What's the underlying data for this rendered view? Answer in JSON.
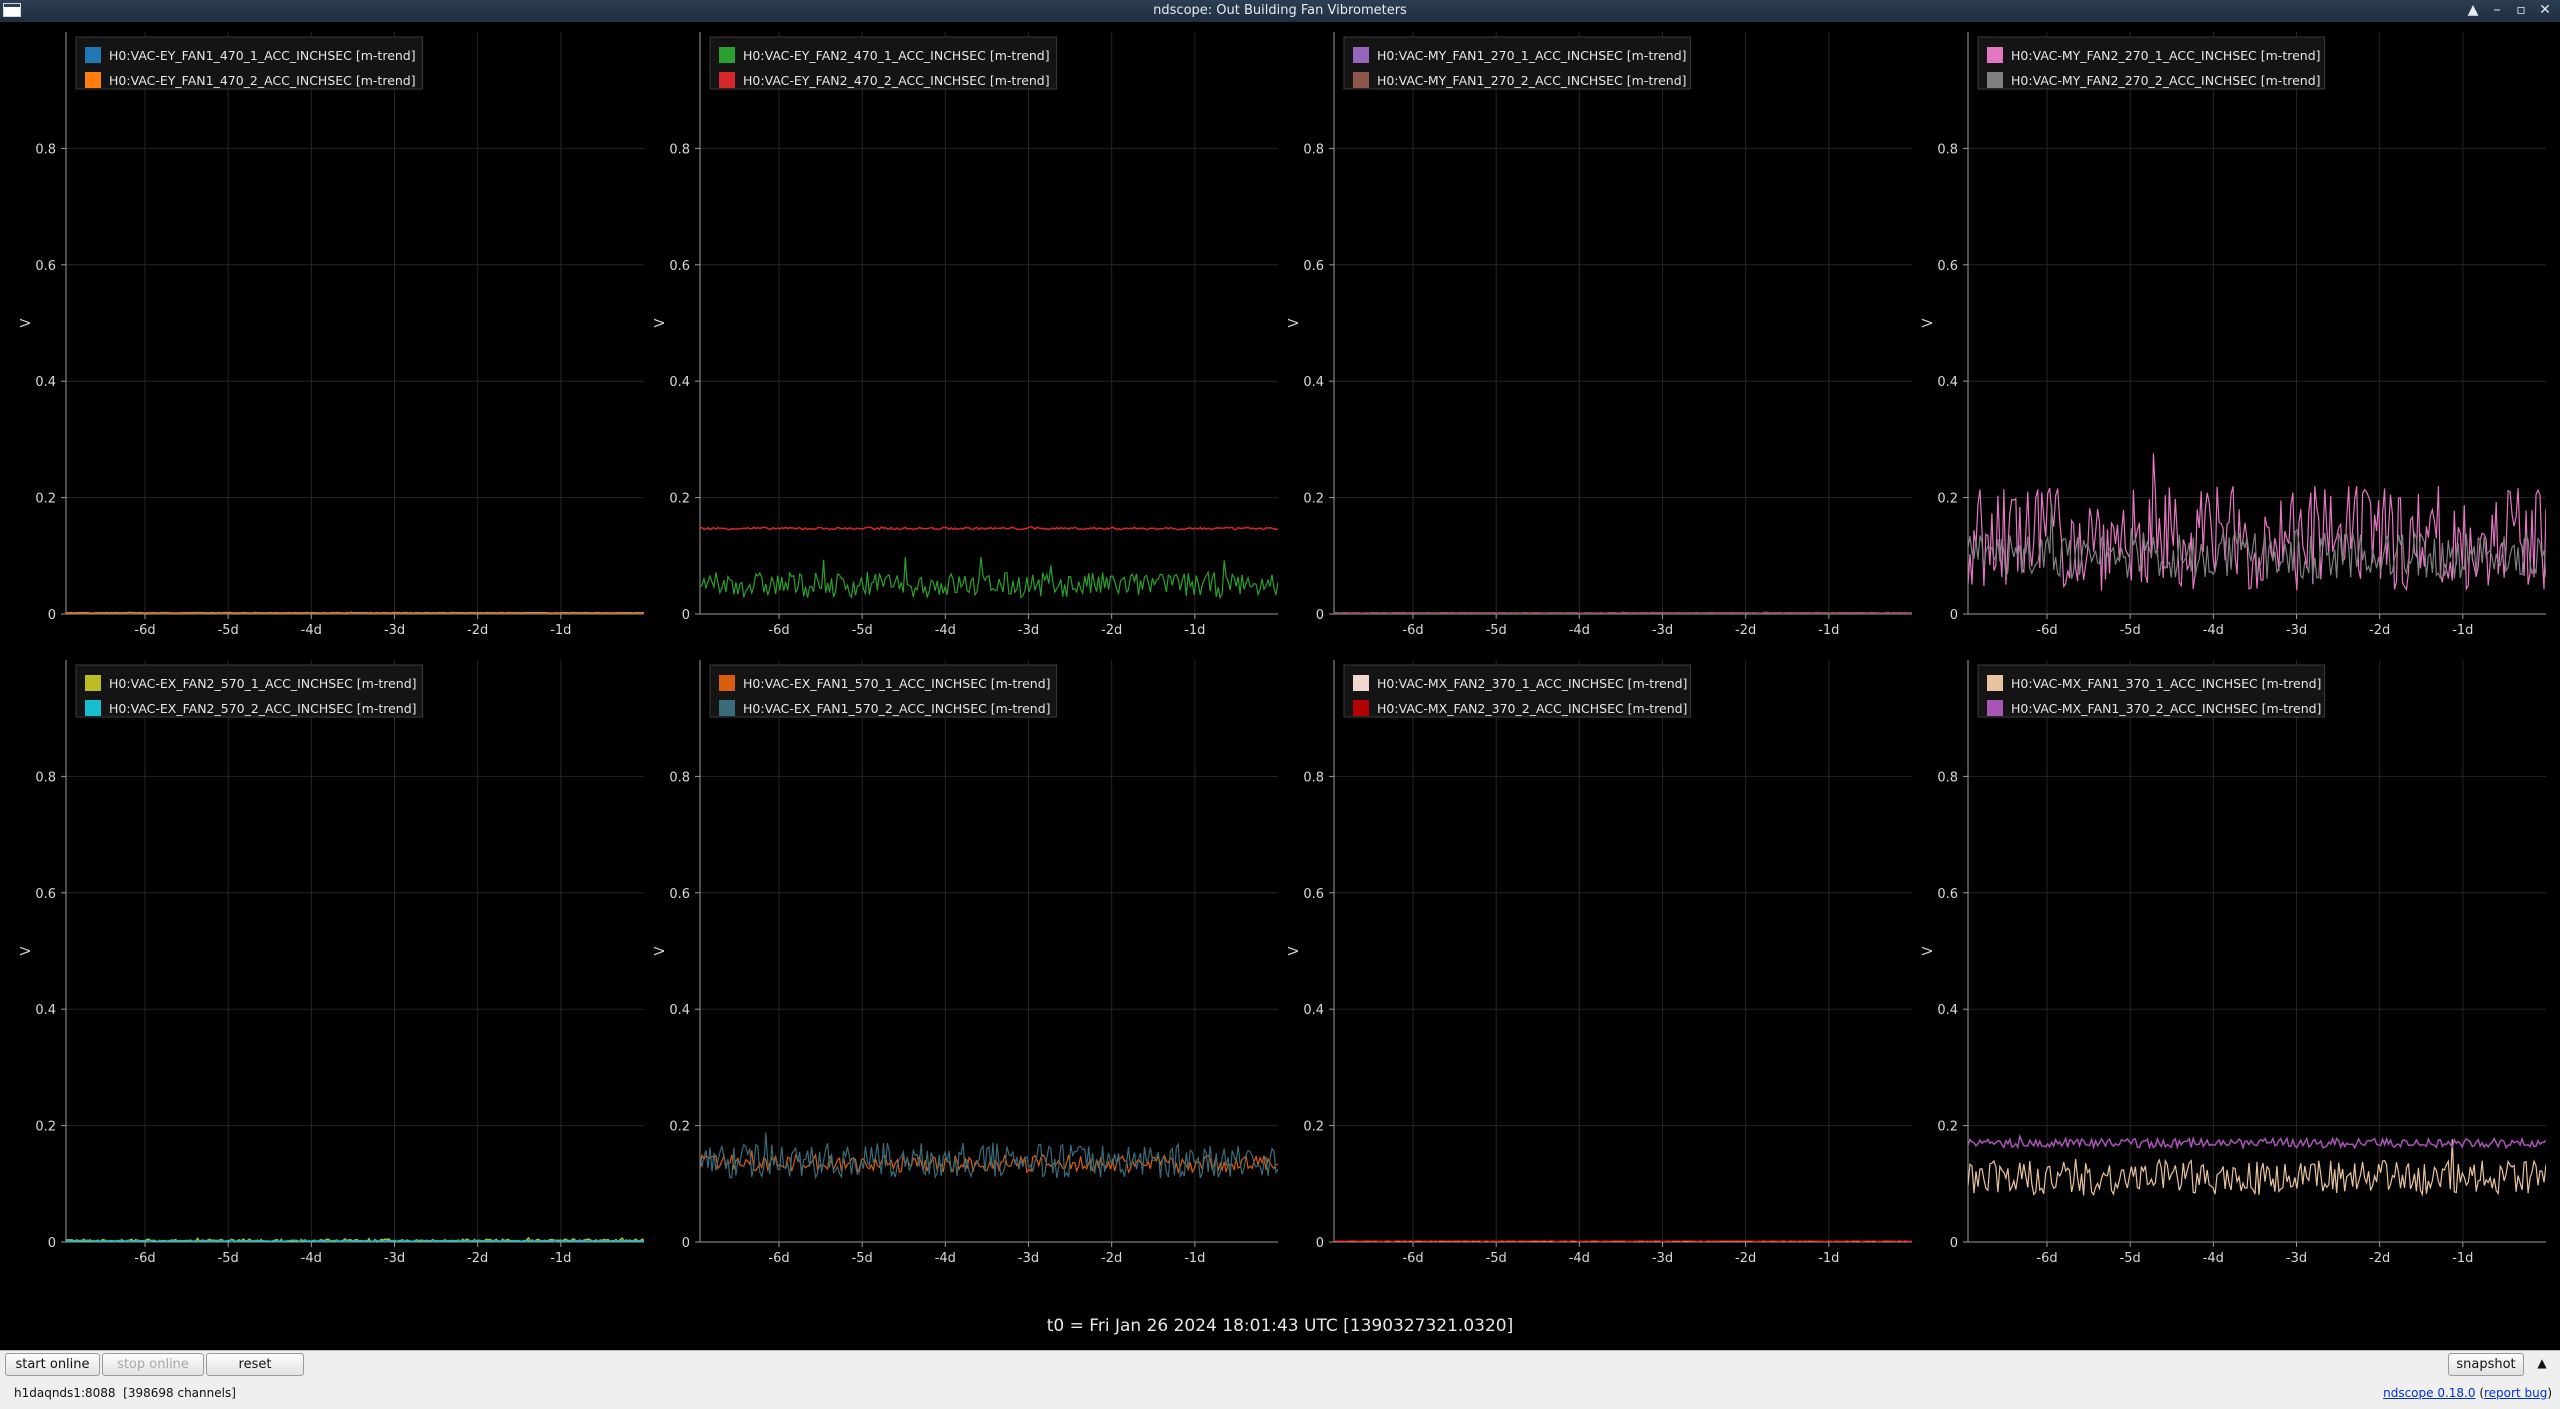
{
  "window": {
    "title": "ndscope: Out Building Fan Vibrometers",
    "controls": [
      "▲",
      "–",
      "▫",
      "✕"
    ]
  },
  "time_axis": {
    "t0_label": "t0 = Fri Jan 26 2024 18:01:43 UTC [1390327321.0320]"
  },
  "buttons": {
    "start_online": "start online",
    "stop_online": "stop online",
    "reset": "reset",
    "snapshot": "snapshot",
    "expand": "▲"
  },
  "status": {
    "server": "h1daqnds1:8088",
    "channels": "[398698 channels]",
    "version_link": "ndscope 0.18.0",
    "report_link": "report bug"
  },
  "chart_data": [
    {
      "type": "line",
      "ylabel": "V",
      "ylim": [
        0,
        1
      ],
      "yticks": [
        0,
        0.2,
        0.4,
        0.6,
        0.8
      ],
      "xticks": [
        "-6d",
        "-5d",
        "-4d",
        "-3d",
        "-2d",
        "-1d"
      ],
      "xlim": [
        -6.95,
        0
      ],
      "grid": true,
      "legend": "top-left",
      "series": [
        {
          "name": "H0:VAC-EY_FAN1_470_1_ACC_INCHSEC [m-trend]",
          "color": "#1f77b4",
          "level": 0.001,
          "spread": 0.0005
        },
        {
          "name": "H0:VAC-EY_FAN1_470_2_ACC_INCHSEC [m-trend]",
          "color": "#ff7f0e",
          "level": 0.002,
          "spread": 0.0005
        }
      ]
    },
    {
      "type": "line",
      "ylabel": "V",
      "ylim": [
        0,
        1
      ],
      "yticks": [
        0,
        0.2,
        0.4,
        0.6,
        0.8
      ],
      "xticks": [
        "-6d",
        "-5d",
        "-4d",
        "-3d",
        "-2d",
        "-1d"
      ],
      "xlim": [
        -6.95,
        0
      ],
      "grid": true,
      "legend": "top-left",
      "series": [
        {
          "name": "H0:VAC-EY_FAN2_470_1_ACC_INCHSEC [m-trend]",
          "color": "#2ca02c",
          "level": 0.05,
          "spread": 0.022
        },
        {
          "name": "H0:VAC-EY_FAN2_470_2_ACC_INCHSEC [m-trend]",
          "color": "#d62728",
          "level": 0.147,
          "spread": 0.002
        }
      ]
    },
    {
      "type": "line",
      "ylabel": "V",
      "ylim": [
        0,
        1
      ],
      "yticks": [
        0,
        0.2,
        0.4,
        0.6,
        0.8
      ],
      "xticks": [
        "-6d",
        "-5d",
        "-4d",
        "-3d",
        "-2d",
        "-1d"
      ],
      "xlim": [
        -6.95,
        0
      ],
      "grid": true,
      "legend": "top-left",
      "series": [
        {
          "name": "H0:VAC-MY_FAN1_270_1_ACC_INCHSEC [m-trend]",
          "color": "#9467bd",
          "level": 0.001,
          "spread": 0.0005
        },
        {
          "name": "H0:VAC-MY_FAN1_270_2_ACC_INCHSEC [m-trend]",
          "color": "#8c564b",
          "level": 0.002,
          "spread": 0.0005
        }
      ]
    },
    {
      "type": "line",
      "ylabel": "V",
      "ylim": [
        0,
        1
      ],
      "yticks": [
        0,
        0.2,
        0.4,
        0.6,
        0.8
      ],
      "xticks": [
        "-6d",
        "-5d",
        "-4d",
        "-3d",
        "-2d",
        "-1d"
      ],
      "xlim": [
        -6.95,
        0
      ],
      "grid": true,
      "legend": "top-left",
      "series": [
        {
          "name": "H0:VAC-MY_FAN2_270_1_ACC_INCHSEC [m-trend]",
          "color": "#e377c2",
          "level": 0.13,
          "spread": 0.09
        },
        {
          "name": "H0:VAC-MY_FAN2_270_2_ACC_INCHSEC [m-trend]",
          "color": "#7f7f7f",
          "level": 0.1,
          "spread": 0.04
        }
      ]
    },
    {
      "type": "line",
      "ylabel": "V",
      "ylim": [
        0,
        1
      ],
      "yticks": [
        0,
        0.2,
        0.4,
        0.6,
        0.8
      ],
      "xticks": [
        "-6d",
        "-5d",
        "-4d",
        "-3d",
        "-2d",
        "-1d"
      ],
      "xlim": [
        -6.95,
        0
      ],
      "grid": true,
      "legend": "top-left",
      "series": [
        {
          "name": "H0:VAC-EX_FAN2_570_1_ACC_INCHSEC [m-trend]",
          "color": "#bcbd22",
          "level": 0.002,
          "spread": 0.003
        },
        {
          "name": "H0:VAC-EX_FAN2_570_2_ACC_INCHSEC [m-trend]",
          "color": "#17becf",
          "level": 0.002,
          "spread": 0.001
        }
      ]
    },
    {
      "type": "line",
      "ylabel": "V",
      "ylim": [
        0,
        1
      ],
      "yticks": [
        0,
        0.2,
        0.4,
        0.6,
        0.8
      ],
      "xticks": [
        "-6d",
        "-5d",
        "-4d",
        "-3d",
        "-2d",
        "-1d"
      ],
      "xlim": [
        -6.95,
        0
      ],
      "grid": true,
      "legend": "top-left",
      "series": [
        {
          "name": "H0:VAC-EX_FAN1_570_1_ACC_INCHSEC [m-trend]",
          "color": "#d95f0e",
          "level": 0.135,
          "spread": 0.015
        },
        {
          "name": "H0:VAC-EX_FAN1_570_2_ACC_INCHSEC [m-trend]",
          "color": "#3a6b7a",
          "level": 0.14,
          "spread": 0.03
        }
      ]
    },
    {
      "type": "line",
      "ylabel": "V",
      "ylim": [
        0,
        1
      ],
      "yticks": [
        0,
        0.2,
        0.4,
        0.6,
        0.8
      ],
      "xticks": [
        "-6d",
        "-5d",
        "-4d",
        "-3d",
        "-2d",
        "-1d"
      ],
      "xlim": [
        -6.95,
        0
      ],
      "grid": true,
      "legend": "top-left",
      "series": [
        {
          "name": "H0:VAC-MX_FAN2_370_1_ACC_INCHSEC [m-trend]",
          "color": "#f2d7d0",
          "level": 0.001,
          "spread": 0.0005
        },
        {
          "name": "H0:VAC-MX_FAN2_370_2_ACC_INCHSEC [m-trend]",
          "color": "#b30000",
          "level": 0.002,
          "spread": 0.0005
        }
      ]
    },
    {
      "type": "line",
      "ylabel": "V",
      "ylim": [
        0,
        1
      ],
      "yticks": [
        0,
        0.2,
        0.4,
        0.6,
        0.8
      ],
      "xticks": [
        "-6d",
        "-5d",
        "-4d",
        "-3d",
        "-2d",
        "-1d"
      ],
      "xlim": [
        -6.95,
        0
      ],
      "grid": true,
      "legend": "top-left",
      "series": [
        {
          "name": "H0:VAC-MX_FAN1_370_1_ACC_INCHSEC [m-trend]",
          "color": "#e8c39e",
          "level": 0.11,
          "spread": 0.03
        },
        {
          "name": "H0:VAC-MX_FAN1_370_2_ACC_INCHSEC [m-trend]",
          "color": "#a855b5",
          "level": 0.17,
          "spread": 0.008
        }
      ]
    }
  ]
}
